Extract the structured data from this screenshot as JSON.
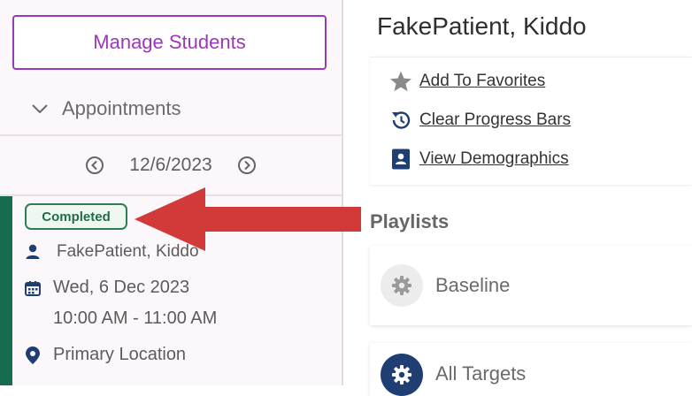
{
  "sidebar": {
    "manage_button": "Manage Students",
    "section_label": "Appointments",
    "date": "12/6/2023"
  },
  "appointment": {
    "status": "Completed",
    "patient": "FakePatient, Kiddo",
    "date": "Wed, 6 Dec 2023",
    "time": "10:00 AM - 11:00 AM",
    "location": "Primary Location"
  },
  "main": {
    "patient_name": "FakePatient, Kiddo",
    "actions": {
      "favorite": "Add To Favorites",
      "clear": "Clear Progress Bars",
      "demographics": "View Demographics"
    },
    "playlists_title": "Playlists",
    "playlists": [
      {
        "label": "Baseline"
      },
      {
        "label": "All Targets"
      }
    ]
  },
  "colors": {
    "brand_purple": "#9a39b8",
    "status_green": "#166c4e",
    "annotation_red": "#d23a3a",
    "navy_icon": "#1f3f73"
  },
  "icons": {
    "appt_header": "chevron-down-icon",
    "prev_date": "chevron-left-circle-icon",
    "next_date": "chevron-right-circle-icon",
    "patient": "person-icon",
    "date": "calendar-icon",
    "location": "map-pin-icon",
    "favorite": "star-icon",
    "clear": "history-icon",
    "demographics": "contact-card-icon",
    "playlist": "gear-icon"
  }
}
